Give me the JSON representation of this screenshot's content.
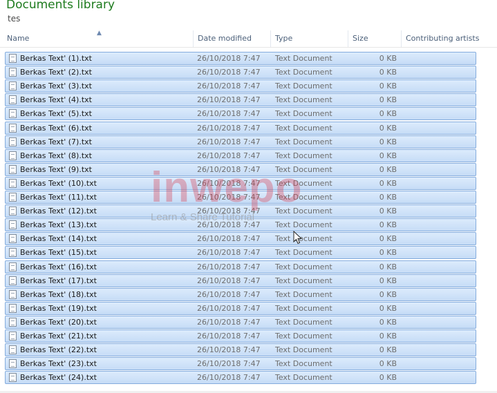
{
  "library": {
    "title": "Documents library",
    "subtitle": "tes"
  },
  "columns": {
    "name": "Name",
    "date_modified": "Date modified",
    "type": "Type",
    "size": "Size",
    "contributing_artists": "Contributing artists"
  },
  "files": [
    {
      "name": "Berkas Text' (1).txt",
      "date": "26/10/2018 7:47",
      "type": "Text Document",
      "size": "0 KB"
    },
    {
      "name": "Berkas Text' (2).txt",
      "date": "26/10/2018 7:47",
      "type": "Text Document",
      "size": "0 KB"
    },
    {
      "name": "Berkas Text' (3).txt",
      "date": "26/10/2018 7:47",
      "type": "Text Document",
      "size": "0 KB"
    },
    {
      "name": "Berkas Text' (4).txt",
      "date": "26/10/2018 7:47",
      "type": "Text Document",
      "size": "0 KB"
    },
    {
      "name": "Berkas Text' (5).txt",
      "date": "26/10/2018 7:47",
      "type": "Text Document",
      "size": "0 KB"
    },
    {
      "name": "Berkas Text' (6).txt",
      "date": "26/10/2018 7:47",
      "type": "Text Document",
      "size": "0 KB"
    },
    {
      "name": "Berkas Text' (7).txt",
      "date": "26/10/2018 7:47",
      "type": "Text Document",
      "size": "0 KB"
    },
    {
      "name": "Berkas Text' (8).txt",
      "date": "26/10/2018 7:47",
      "type": "Text Document",
      "size": "0 KB"
    },
    {
      "name": "Berkas Text' (9).txt",
      "date": "26/10/2018 7:47",
      "type": "Text Document",
      "size": "0 KB"
    },
    {
      "name": "Berkas Text' (10).txt",
      "date": "26/10/2018 7:47",
      "type": "Text Document",
      "size": "0 KB"
    },
    {
      "name": "Berkas Text' (11).txt",
      "date": "26/10/2018 7:47",
      "type": "Text Document",
      "size": "0 KB"
    },
    {
      "name": "Berkas Text' (12).txt",
      "date": "26/10/2018 7:47",
      "type": "Text Document",
      "size": "0 KB"
    },
    {
      "name": "Berkas Text' (13).txt",
      "date": "26/10/2018 7:47",
      "type": "Text Document",
      "size": "0 KB"
    },
    {
      "name": "Berkas Text' (14).txt",
      "date": "26/10/2018 7:47",
      "type": "Text Document",
      "size": "0 KB"
    },
    {
      "name": "Berkas Text' (15).txt",
      "date": "26/10/2018 7:47",
      "type": "Text Document",
      "size": "0 KB"
    },
    {
      "name": "Berkas Text' (16).txt",
      "date": "26/10/2018 7:47",
      "type": "Text Document",
      "size": "0 KB"
    },
    {
      "name": "Berkas Text' (17).txt",
      "date": "26/10/2018 7:47",
      "type": "Text Document",
      "size": "0 KB"
    },
    {
      "name": "Berkas Text' (18).txt",
      "date": "26/10/2018 7:47",
      "type": "Text Document",
      "size": "0 KB"
    },
    {
      "name": "Berkas Text' (19).txt",
      "date": "26/10/2018 7:47",
      "type": "Text Document",
      "size": "0 KB"
    },
    {
      "name": "Berkas Text' (20).txt",
      "date": "26/10/2018 7:47",
      "type": "Text Document",
      "size": "0 KB"
    },
    {
      "name": "Berkas Text' (21).txt",
      "date": "26/10/2018 7:47",
      "type": "Text Document",
      "size": "0 KB"
    },
    {
      "name": "Berkas Text' (22).txt",
      "date": "26/10/2018 7:47",
      "type": "Text Document",
      "size": "0 KB"
    },
    {
      "name": "Berkas Text' (23).txt",
      "date": "26/10/2018 7:47",
      "type": "Text Document",
      "size": "0 KB"
    },
    {
      "name": "Berkas Text' (24).txt",
      "date": "26/10/2018 7:47",
      "type": "Text Document",
      "size": "0 KB"
    }
  ],
  "watermark": {
    "logo": "inwepo",
    "tagline": "Learn & Share Tutorial"
  },
  "colors": {
    "title_green": "#1e7b1e",
    "selection_fill": "#cde1f8",
    "selection_border": "#84acdd"
  },
  "icons": {
    "file": "text-file-icon",
    "sort": "sort-ascending-icon",
    "cursor": "mouse-pointer-icon"
  }
}
